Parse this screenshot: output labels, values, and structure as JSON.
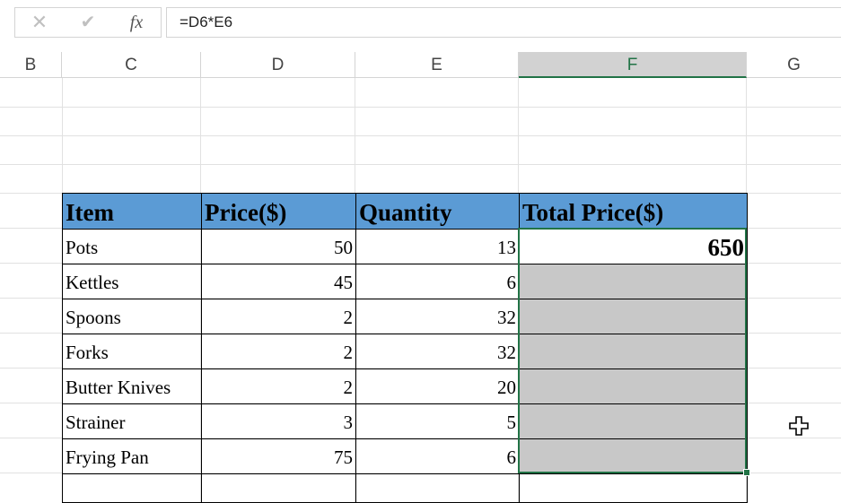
{
  "formula_bar": {
    "cancel_icon": "cancel-icon",
    "enter_icon": "enter-icon",
    "fx_label": "fx",
    "formula": "=D6*E6"
  },
  "columns": {
    "b": "B",
    "c": "C",
    "d": "D",
    "e": "E",
    "f": "F",
    "g": "G"
  },
  "selected_column": "F",
  "table": {
    "headers": [
      "Item",
      "Price($)",
      "Quantity",
      "Total Price($)"
    ],
    "rows": [
      {
        "item": "Pots",
        "price": "50",
        "quantity": "13",
        "total": "650"
      },
      {
        "item": "Kettles",
        "price": "45",
        "quantity": "6",
        "total": ""
      },
      {
        "item": "Spoons",
        "price": "2",
        "quantity": "32",
        "total": ""
      },
      {
        "item": "Forks",
        "price": "2",
        "quantity": "32",
        "total": ""
      },
      {
        "item": "Butter Knives",
        "price": "2",
        "quantity": "20",
        "total": ""
      },
      {
        "item": "Strainer",
        "price": "3",
        "quantity": "5",
        "total": ""
      },
      {
        "item": "Frying Pan",
        "price": "75",
        "quantity": "6",
        "total": ""
      }
    ]
  },
  "colors": {
    "header_fill": "#5b9bd5",
    "selection_green": "#217346",
    "selected_fill": "#c8c8c8"
  }
}
